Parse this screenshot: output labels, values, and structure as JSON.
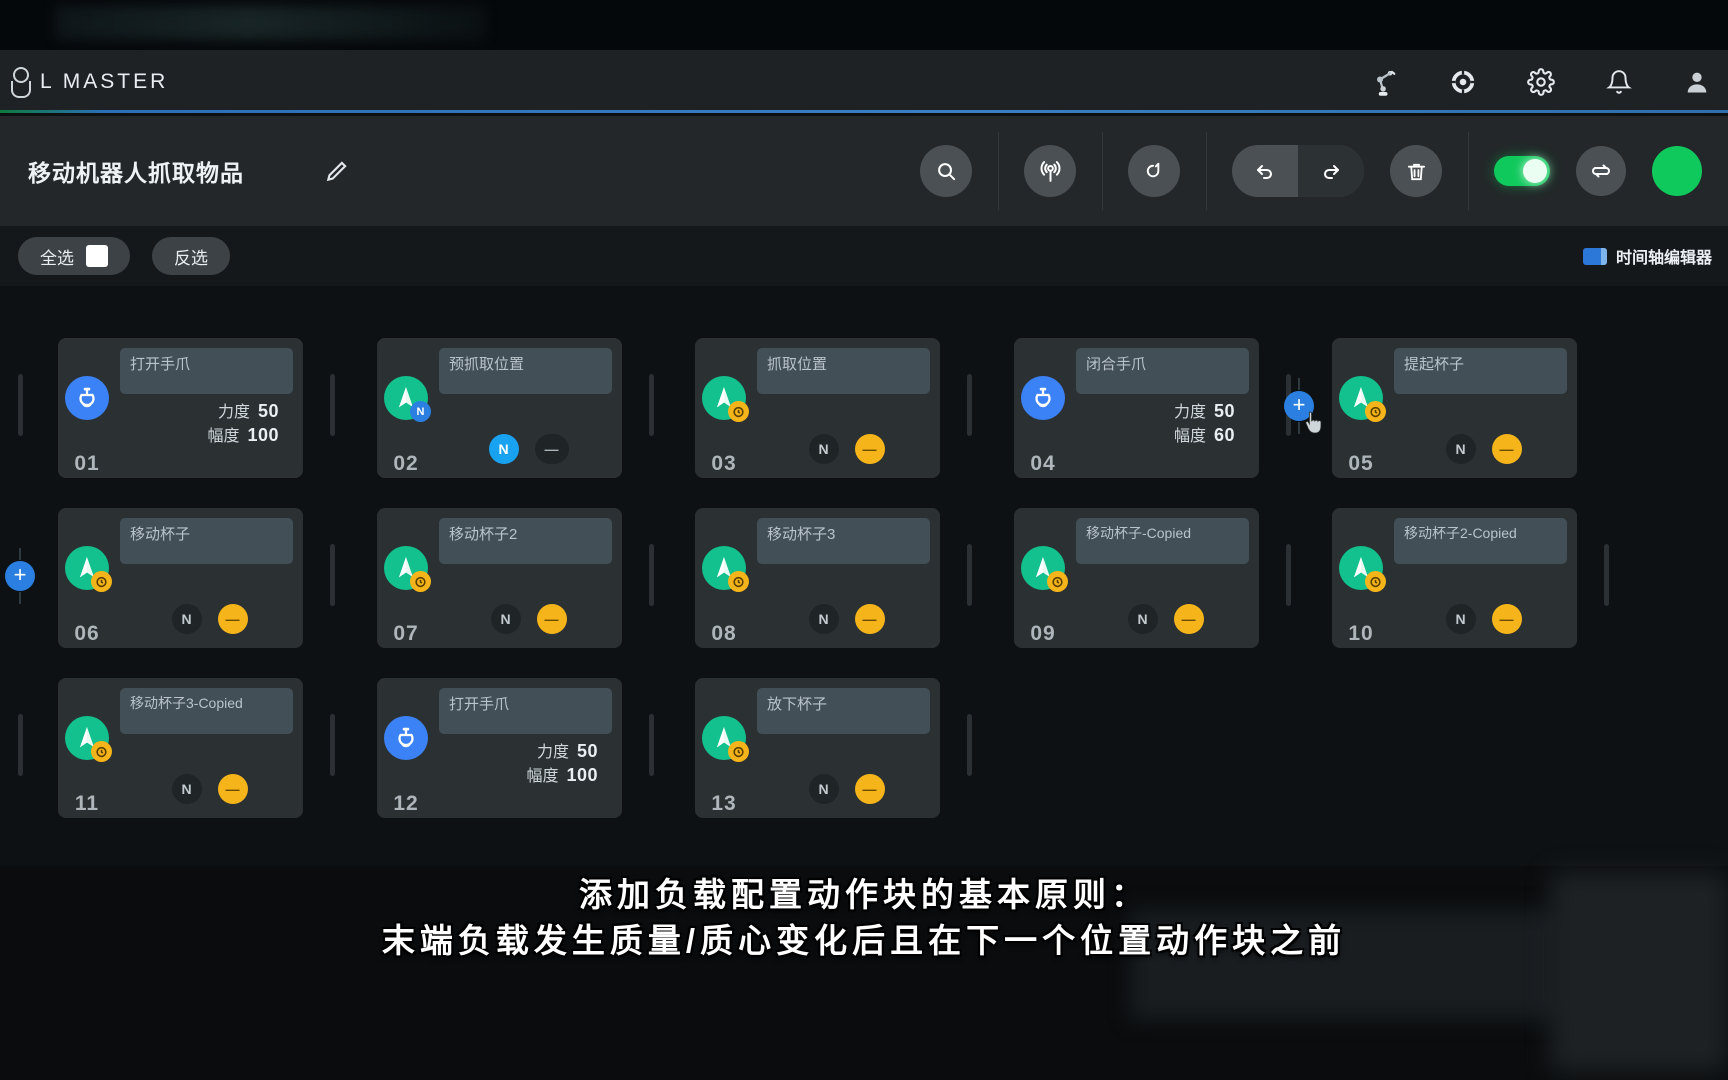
{
  "header": {
    "logo_text": "L MASTER",
    "icons": [
      {
        "name": "robot-arm-icon"
      },
      {
        "name": "target-icon"
      },
      {
        "name": "gear-icon"
      },
      {
        "name": "bell-icon"
      },
      {
        "name": "user-avatar-icon"
      }
    ]
  },
  "toolbar": {
    "project_title": "移动机器人抓取物品",
    "edit_icon": "pencil-icon",
    "search_icon": "search-icon",
    "teach_icon": "broadcast-icon",
    "loop_icon": "refresh-icon",
    "undo_icon": "undo-icon",
    "redo_icon": "redo-icon",
    "delete_icon": "trash-icon",
    "power_toggle_on": true,
    "repeat_icon": "repeat-icon"
  },
  "selectbar": {
    "select_all": "全选",
    "select_all_checked": false,
    "invert_select": "反选",
    "timeline_editor": "时间轴编辑器",
    "timeline_icon": "timeline-icon"
  },
  "cards": [
    {
      "index": "01",
      "name": "打开手爪",
      "type": "gripper",
      "icon": "gripper-icon",
      "badge": null,
      "params": [
        {
          "label": "力度",
          "value": "50"
        },
        {
          "label": "幅度",
          "value": "100"
        }
      ],
      "chips": []
    },
    {
      "index": "02",
      "name": "预抓取位置",
      "type": "move",
      "icon": "navigate-icon",
      "badge": {
        "kind": "blue",
        "glyph": "N"
      },
      "params": [],
      "chips": [
        {
          "kind": "blue",
          "glyph": "N"
        },
        {
          "kind": "ghost",
          "glyph": "—"
        }
      ]
    },
    {
      "index": "03",
      "name": "抓取位置",
      "type": "move",
      "icon": "navigate-icon",
      "badge": {
        "kind": "amber",
        "glyph": "⏱"
      },
      "params": [],
      "chips": [
        {
          "kind": "dark",
          "glyph": "N"
        },
        {
          "kind": "amber",
          "glyph": "—"
        }
      ]
    },
    {
      "index": "04",
      "name": "闭合手爪",
      "type": "gripper",
      "icon": "gripper-icon",
      "badge": null,
      "params": [
        {
          "label": "力度",
          "value": "50"
        },
        {
          "label": "幅度",
          "value": "60"
        }
      ],
      "chips": []
    },
    {
      "index": "05",
      "name": "提起杯子",
      "type": "move",
      "icon": "navigate-icon",
      "badge": {
        "kind": "amber",
        "glyph": "⏱"
      },
      "params": [],
      "chips": [
        {
          "kind": "dark",
          "glyph": "N"
        },
        {
          "kind": "amber",
          "glyph": "—"
        }
      ]
    },
    {
      "index": "06",
      "name": "移动杯子",
      "type": "move",
      "icon": "navigate-icon",
      "badge": {
        "kind": "amber",
        "glyph": "⏱"
      },
      "params": [],
      "chips": [
        {
          "kind": "dark",
          "glyph": "N"
        },
        {
          "kind": "amber",
          "glyph": "—"
        }
      ]
    },
    {
      "index": "07",
      "name": "移动杯子2",
      "type": "move",
      "icon": "navigate-icon",
      "badge": {
        "kind": "amber",
        "glyph": "⏱"
      },
      "params": [],
      "chips": [
        {
          "kind": "dark",
          "glyph": "N"
        },
        {
          "kind": "amber",
          "glyph": "—"
        }
      ]
    },
    {
      "index": "08",
      "name": "移动杯子3",
      "type": "move",
      "icon": "navigate-icon",
      "badge": {
        "kind": "amber",
        "glyph": "⏱"
      },
      "params": [],
      "chips": [
        {
          "kind": "dark",
          "glyph": "N"
        },
        {
          "kind": "amber",
          "glyph": "—"
        }
      ]
    },
    {
      "index": "09",
      "name": "移动杯子-Copied",
      "type": "move",
      "icon": "navigate-icon",
      "badge": {
        "kind": "amber",
        "glyph": "⏱"
      },
      "params": [],
      "chips": [
        {
          "kind": "dark",
          "glyph": "N"
        },
        {
          "kind": "amber",
          "glyph": "—"
        }
      ]
    },
    {
      "index": "10",
      "name": "移动杯子2-Copied",
      "type": "move",
      "icon": "navigate-icon",
      "badge": {
        "kind": "amber",
        "glyph": "⏱"
      },
      "params": [],
      "chips": [
        {
          "kind": "dark",
          "glyph": "N"
        },
        {
          "kind": "amber",
          "glyph": "—"
        }
      ]
    },
    {
      "index": "11",
      "name": "移动杯子3-Copied",
      "type": "move",
      "icon": "navigate-icon",
      "badge": {
        "kind": "amber",
        "glyph": "⏱"
      },
      "params": [],
      "chips": [
        {
          "kind": "dark",
          "glyph": "N"
        },
        {
          "kind": "amber",
          "glyph": "—"
        }
      ]
    },
    {
      "index": "12",
      "name": "打开手爪",
      "type": "gripper",
      "icon": "gripper-icon",
      "badge": null,
      "params": [
        {
          "label": "力度",
          "value": "50"
        },
        {
          "label": "幅度",
          "value": "100"
        }
      ],
      "chips": []
    },
    {
      "index": "13",
      "name": "放下杯子",
      "type": "move",
      "icon": "navigate-icon",
      "badge": {
        "kind": "amber",
        "glyph": "⏱"
      },
      "params": [],
      "chips": [
        {
          "kind": "dark",
          "glyph": "N"
        },
        {
          "kind": "amber",
          "glyph": "—"
        }
      ]
    }
  ],
  "add_buttons": {
    "after_card_04_label": "+",
    "row2_start_label": "+"
  },
  "subtitle": {
    "line1": "添加负载配置动作块的基本原则：",
    "line2": "末端负载发生质量/质心变化后且在下一个位置动作块之前"
  },
  "colors": {
    "accent_blue": "#3b82f6",
    "accent_green": "#12c18d",
    "accent_amber": "#f5b51a",
    "toggle_green": "#10c95c",
    "panel": "#2b3033"
  }
}
